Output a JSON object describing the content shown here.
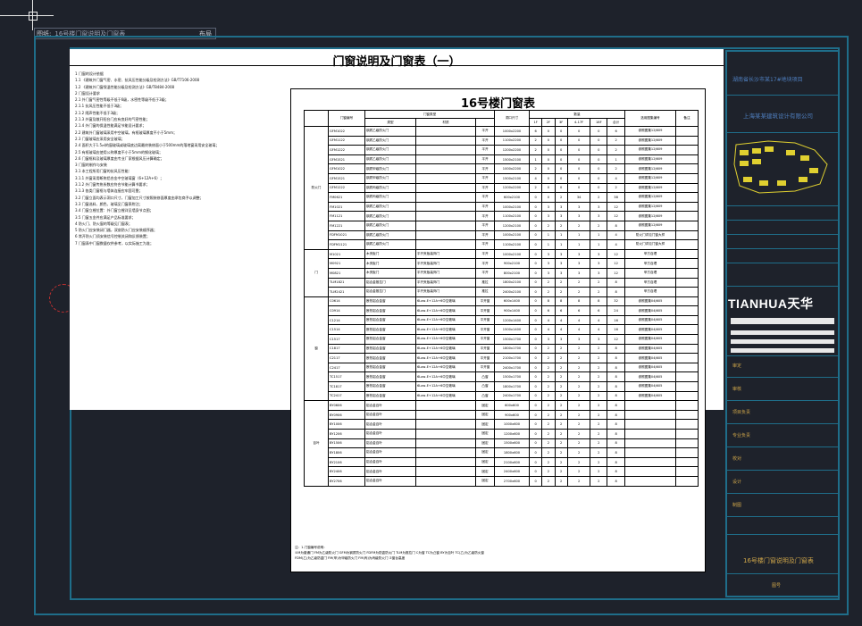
{
  "tab": {
    "file_label": "图纸:",
    "sheet_name": "16号楼门窗说明及门窗表",
    "layout_label": "布局"
  },
  "sheet": {
    "title": "门窗说明及门窗表（一）"
  },
  "notes": [
    "1  门窗的设计依据",
    "1.1  《建筑外门窗气密、水密、抗风压性能分级及检测方法》GB/T7106-2008",
    "1.2  《建筑外门窗保温性能分级及检测方法》GB/T8484-2008",
    "2  门窗设计要求",
    "2.1  外门窗气密性等级不低于6级，水密性等级不低于3级；",
    "2.1.1  抗风压性能不低于3级；",
    "2.1.2  隔声性能不低于3级；",
    "2.1.3  外窗及敞开阳台门应有良好的气密性能；",
    "2.1.4  外门窗的保温性能满足节能设计要求；",
    "2.2  建筑外门窗玻璃采用中空玻璃，有框玻璃厚度不小于5mm；",
    "2.3  门窗玻璃应采用安全玻璃；",
    "2.4  面积大于1.5㎡的窗玻璃或玻璃底边离最终装修面小于500mm的落地窗采用安全玻璃；",
    "2.5  有框玻璃应使用公称厚度不小于5mm的钢化玻璃；",
    "2.6  门窗框料及玻璃厚度由专业厂家根据风压计算确定；",
    "3  门窗的制作与安装",
    "3.1  本工程所用门窗的抗风压性能：",
    "3.1.1  外窗采用断热铝合金中空玻璃窗（6+12A+6）；",
    "3.1.2  外门窗传热系数应符合节能计算书要求；",
    "3.1.3  各类门窗框与墙体连接应牢固可靠；",
    "3.2  门窗立面均表示洞口尺寸，门窗加工尺寸按照装修面厚度由承包商予以调整；",
    "3.3  门窗选料、颜色、玻璃见门窗表附注；",
    "3.4  门窗立樘位置：外门窗立樘详见墙身节点图；",
    "3.5  门窗五金件应满足产品标准要求；",
    "4  防火门、防火窗的等级见门窗表；",
    "5  防火门应安装闭门器，双扇防火门应安装顺序器；",
    "6  常开防火门须安装信号控制关闭和反馈装置；",
    "7  门窗表中门窗数量仅供参考，以实际施工为准；"
  ],
  "door_table": {
    "title": "16号楼门窗表",
    "headers": [
      "门窗编号",
      "门窗类型",
      "",
      "洞口尺寸",
      "数量",
      "",
      "",
      "",
      "",
      "",
      "选用图集编号",
      "备注"
    ],
    "subheaders": [
      "",
      "类型",
      "材质",
      "",
      "(宽x高)",
      "1F",
      "2F",
      "3F",
      "4-17F",
      "18F",
      "合计",
      "",
      ""
    ],
    "groups": [
      "防火门",
      "门",
      "窗",
      "百叶"
    ],
    "rows": [
      [
        "GFM1022",
        "钢质乙级防火门",
        "",
        "平开",
        "1000x2200",
        "6",
        "0",
        "0",
        "0",
        "0",
        "6",
        "参照图集12J609"
      ],
      [
        "GFM1122",
        "钢质乙级防火门",
        "",
        "平开",
        "1100x2200",
        "2",
        "0",
        "0",
        "0",
        "0",
        "2",
        "参照图集12J609"
      ],
      [
        "GFM1222",
        "钢质乙级防火门",
        "",
        "平开",
        "1200x2200",
        "2",
        "0",
        "0",
        "0",
        "0",
        "2",
        "参照图集12J609"
      ],
      [
        "GFM1521",
        "钢质乙级防火门",
        "",
        "平开",
        "1500x2100",
        "1",
        "0",
        "0",
        "0",
        "0",
        "1",
        "参照图集12J609"
      ],
      [
        "GFM1022",
        "钢质甲级防火门",
        "",
        "平开",
        "1000x2200",
        "2",
        "0",
        "0",
        "0",
        "0",
        "2",
        "参照图集12J609"
      ],
      [
        "GFM1521",
        "钢质甲级防火门",
        "",
        "平开",
        "1500x2100",
        "4",
        "0",
        "0",
        "0",
        "0",
        "4",
        "参照图集12J609"
      ],
      [
        "GFM1222",
        "钢质丙级防火门",
        "",
        "平开",
        "1200x2200",
        "2",
        "0",
        "0",
        "0",
        "0",
        "2",
        "参照图集12J609"
      ],
      [
        "FM0621",
        "钢质丙级防火门",
        "",
        "平开",
        "600x2100",
        "0",
        "0",
        "2",
        "34",
        "2",
        "38",
        "参照图集12J609"
      ],
      [
        "FM1021",
        "钢质乙级防火门",
        "",
        "平开",
        "1000x2100",
        "0",
        "3",
        "3",
        "3",
        "3",
        "12",
        "参照图集12J609"
      ],
      [
        "FM1121",
        "钢质乙级防火门",
        "",
        "平开",
        "1100x2100",
        "0",
        "3",
        "3",
        "3",
        "3",
        "12",
        "参照图集12J609"
      ],
      [
        "FM1221",
        "钢质乙级防火门",
        "",
        "平开",
        "1200x2100",
        "0",
        "2",
        "2",
        "2",
        "2",
        "8",
        "参照图集12J609"
      ],
      [
        "FDFM1021",
        "钢质乙级防火门",
        "",
        "平开",
        "1000x2100",
        "0",
        "1",
        "1",
        "1",
        "1",
        "4",
        "防火门详见门窗大样"
      ],
      [
        "FDFM1121",
        "钢质乙级防火门",
        "",
        "平开",
        "1100x2100",
        "0",
        "1",
        "1",
        "1",
        "1",
        "4",
        "防火门详见门窗大样"
      ],
      [
        "M1021",
        "木夹板门",
        "平开夹板装饰门",
        "平开",
        "1000x2100",
        "0",
        "3",
        "3",
        "3",
        "3",
        "12",
        "甲方自理"
      ],
      [
        "M0921",
        "木夹板门",
        "平开夹板装饰门",
        "平开",
        "900x2100",
        "0",
        "3",
        "3",
        "3",
        "3",
        "12",
        "甲方自理"
      ],
      [
        "M0821",
        "木夹板门",
        "平开夹板装饰门",
        "平开",
        "800x2100",
        "0",
        "3",
        "3",
        "3",
        "3",
        "12",
        "甲方自理"
      ],
      [
        "TLM1821",
        "铝合金推拉门",
        "平开夹板装饰门",
        "推拉",
        "1800x2100",
        "0",
        "2",
        "2",
        "2",
        "2",
        "8",
        "甲方自理"
      ],
      [
        "TLM2421",
        "铝合金推拉门",
        "平开夹板装饰门",
        "推拉",
        "2400x2100",
        "0",
        "2",
        "2",
        "2",
        "2",
        "8",
        "甲方自理"
      ],
      [
        "C0614",
        "断热铝合金窗",
        "6Low-E+12A+6中空玻璃",
        "平开窗",
        "600x1400",
        "0",
        "8",
        "8",
        "8",
        "8",
        "32",
        "参照图集04J605"
      ],
      [
        "C0914",
        "断热铝合金窗",
        "6Low-E+12A+6中空玻璃",
        "平开窗",
        "900x1400",
        "0",
        "6",
        "6",
        "6",
        "6",
        "24",
        "参照图集04J605"
      ],
      [
        "C1214",
        "断热铝合金窗",
        "6Low-E+12A+6中空玻璃",
        "平开窗",
        "1200x1400",
        "0",
        "4",
        "4",
        "4",
        "4",
        "16",
        "参照图集04J605"
      ],
      [
        "C1514",
        "断热铝合金窗",
        "6Low-E+12A+6中空玻璃",
        "平开窗",
        "1500x1400",
        "0",
        "4",
        "4",
        "4",
        "4",
        "16",
        "参照图集04J605"
      ],
      [
        "C1517",
        "断热铝合金窗",
        "6Low-E+12A+6中空玻璃",
        "平开窗",
        "1500x1700",
        "0",
        "3",
        "3",
        "3",
        "3",
        "12",
        "参照图集04J605"
      ],
      [
        "C1817",
        "断热铝合金窗",
        "6Low-E+12A+6中空玻璃",
        "平开窗",
        "1800x1700",
        "0",
        "2",
        "2",
        "2",
        "2",
        "8",
        "参照图集04J605"
      ],
      [
        "C2117",
        "断热铝合金窗",
        "6Low-E+12A+6中空玻璃",
        "平开窗",
        "2100x1700",
        "0",
        "2",
        "2",
        "2",
        "2",
        "8",
        "参照图集04J605"
      ],
      [
        "C2417",
        "断热铝合金窗",
        "6Low-E+12A+6中空玻璃",
        "平开窗",
        "2400x1700",
        "0",
        "2",
        "2",
        "2",
        "2",
        "8",
        "参照图集04J605"
      ],
      [
        "TC1517",
        "断热铝合金窗",
        "6Low-E+12A+6中空玻璃",
        "凸窗",
        "1500x1700",
        "0",
        "2",
        "2",
        "2",
        "2",
        "8",
        "参照图集04J605"
      ],
      [
        "TC1817",
        "断热铝合金窗",
        "6Low-E+12A+6中空玻璃",
        "凸窗",
        "1800x1700",
        "0",
        "2",
        "2",
        "2",
        "2",
        "8",
        "参照图集04J605"
      ],
      [
        "TC2417",
        "断热铝合金窗",
        "6Low-E+12A+6中空玻璃",
        "凸窗",
        "2400x1700",
        "0",
        "2",
        "2",
        "2",
        "2",
        "8",
        "参照图集04J605"
      ],
      [
        "BY0606",
        "铝合金百叶",
        "",
        "固定",
        "600x600",
        "0",
        "2",
        "2",
        "2",
        "2",
        "8",
        ""
      ],
      [
        "BY0906",
        "铝合金百叶",
        "",
        "固定",
        "900x600",
        "0",
        "2",
        "2",
        "2",
        "2",
        "8",
        ""
      ],
      [
        "BY1006",
        "铝合金百叶",
        "",
        "固定",
        "1000x600",
        "0",
        "2",
        "2",
        "2",
        "2",
        "8",
        ""
      ],
      [
        "BY1206",
        "铝合金百叶",
        "",
        "固定",
        "1200x600",
        "0",
        "2",
        "2",
        "2",
        "2",
        "8",
        ""
      ],
      [
        "BY1506",
        "铝合金百叶",
        "",
        "固定",
        "1500x600",
        "0",
        "2",
        "2",
        "2",
        "2",
        "8",
        ""
      ],
      [
        "BY1806",
        "铝合金百叶",
        "",
        "固定",
        "1800x600",
        "0",
        "2",
        "2",
        "2",
        "2",
        "8",
        ""
      ],
      [
        "BY2106",
        "铝合金百叶",
        "",
        "固定",
        "2100x600",
        "0",
        "2",
        "2",
        "2",
        "2",
        "8",
        ""
      ],
      [
        "BY2406",
        "铝合金百叶",
        "",
        "固定",
        "2400x600",
        "0",
        "2",
        "2",
        "2",
        "2",
        "8",
        ""
      ],
      [
        "BY2706",
        "铝合金百叶",
        "",
        "固定",
        "2700x600",
        "0",
        "2",
        "2",
        "2",
        "2",
        "8",
        ""
      ]
    ],
    "legend": [
      "注：1.门窗编号说明：",
      "①M为普通门  FM为乙级防火门  GFM为钢质防火门  FDFM为防盗防火门  TLM为推拉门  C为窗  TC为凸窗  BY为百叶  TC(乙)为乙级防火窗",
      "FDM(乙)为乙级防盗门  FM(甲)为甲级防火门  FM(丙)为丙级防火门  ②窗台高度"
    ]
  },
  "titleblock": {
    "project_line": "湖南省长沙市某17#地块项目",
    "company": "上海某某建筑设计有限公司",
    "logo_text": "TIANHUA天华",
    "sheet_name": "16号楼门窗说明及门窗表",
    "labels": [
      "审定",
      "审核",
      "项目负责",
      "专业负责",
      "校对",
      "设计",
      "制图"
    ],
    "sheet_no_label": "图号"
  },
  "colors": {
    "background": "#1e222b",
    "frame": "#1f6e8a",
    "title_yellow": "#cfa64a",
    "logo_white": "#ffffff"
  }
}
